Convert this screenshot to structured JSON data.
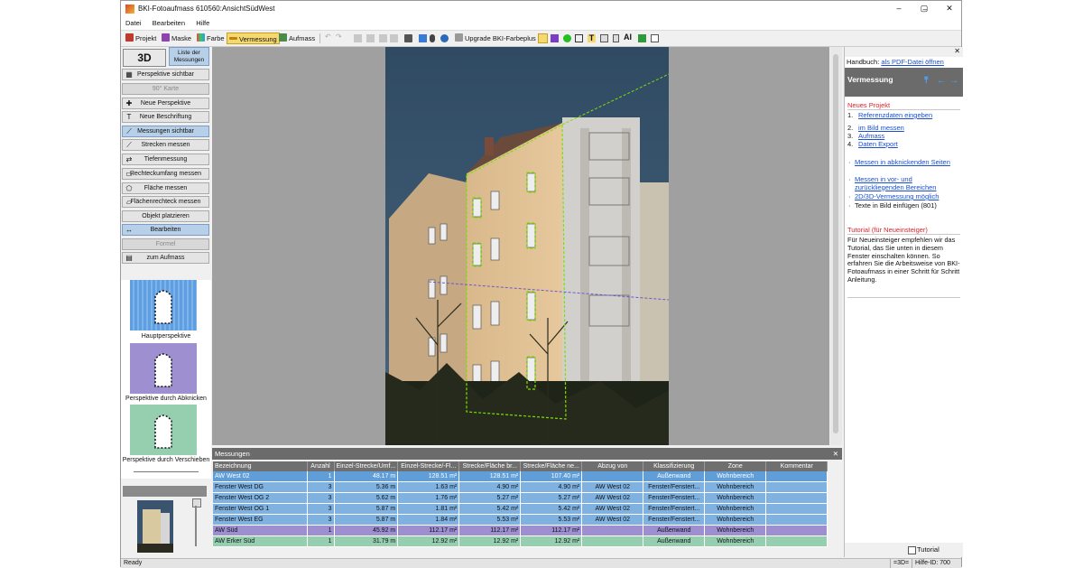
{
  "window": {
    "title": "BKI-Fotoaufmass 610560:AnsichtSüdWest"
  },
  "menu": [
    "Datei",
    "Bearbeiten",
    "Hilfe"
  ],
  "toolbar": {
    "projekt": "Projekt",
    "maske": "Maske",
    "farbe": "Farbe",
    "vermessung": "Vermessung",
    "aufmass": "Aufmass",
    "upgrade": "Upgrade BKI-Farbeplus",
    "ai": "AI",
    "t": "T"
  },
  "left_panel": {
    "btn_3d": "3D",
    "btn_liste": "Liste der Messungen",
    "items": [
      {
        "label": "Perspektive sichtbar",
        "state": "normal",
        "icon": "perspective-icon"
      },
      {
        "label": "90° Karte",
        "state": "disabled",
        "icon": ""
      },
      {
        "label": "Neue Perspektive",
        "state": "normal",
        "icon": "new-perspective-icon"
      },
      {
        "label": "Neue Beschriftung",
        "state": "normal",
        "icon": "text-icon"
      },
      {
        "label": "Messungen sichtbar",
        "state": "selected",
        "icon": "measure-visible-icon"
      },
      {
        "label": "Strecken messen",
        "state": "normal",
        "icon": "distance-icon"
      },
      {
        "label": "Tiefenmessung",
        "state": "normal",
        "icon": "depth-icon"
      },
      {
        "label": "Rechteckumfang messen",
        "state": "normal",
        "icon": "rectangle-icon"
      },
      {
        "label": "Fläche messen",
        "state": "normal",
        "icon": "area-icon"
      },
      {
        "label": "Flächenrechteck messen",
        "state": "normal",
        "icon": "area-rectangle-icon"
      },
      {
        "label": "Objekt platzieren",
        "state": "normal",
        "icon": ""
      },
      {
        "label": "Bearbeiten",
        "state": "selected",
        "icon": "edit-icon"
      },
      {
        "label": "Formel",
        "state": "disabled",
        "icon": ""
      },
      {
        "label": "zum Aufmass",
        "state": "normal",
        "icon": "aufmass-icon"
      }
    ],
    "perspectives": [
      {
        "label": "Hauptperspektive",
        "color": "#5f9ee0"
      },
      {
        "label": "Perspektive durch Abknicken",
        "color": "#9d8fd0"
      },
      {
        "label": "Perspektive durch Verschieben",
        "color": "#95cfb0"
      }
    ]
  },
  "measurements": {
    "panel_title": "Messungen",
    "columns": [
      "Bezeichnung",
      "Anzahl",
      "Einzel-Strecke/Umf...",
      "Einzel-Strecke/-Fl...",
      "Strecke/Fläche br...",
      "Strecke/Fläche ne...",
      "Abzug von",
      "Klassifizierung",
      "Zone",
      "Kommentar"
    ],
    "rows": [
      {
        "name": "AW West 02",
        "count": "1",
        "len": "48.17 m",
        "area": "128.51 m²",
        "gross": "128.51 m²",
        "net": "107.40 m²",
        "abzug": "",
        "klass": "Außenwand",
        "zone": "Wohnbereich",
        "kommentar": "",
        "color": "selected"
      },
      {
        "name": "Fenster West DG",
        "count": "3",
        "len": "5.36 m",
        "area": "1.63 m²",
        "gross": "4.90 m²",
        "net": "4.90 m²",
        "abzug": "AW West 02",
        "klass": "Fenster/Fenstert...",
        "zone": "Wohnbereich",
        "kommentar": "",
        "color": "blue"
      },
      {
        "name": "Fenster West OG 2",
        "count": "3",
        "len": "5.62 m",
        "area": "1.76 m²",
        "gross": "5.27 m²",
        "net": "5.27 m²",
        "abzug": "AW West 02",
        "klass": "Fenster/Fenstert...",
        "zone": "Wohnbereich",
        "kommentar": "",
        "color": "blue"
      },
      {
        "name": "Fenster West OG 1",
        "count": "3",
        "len": "5.87 m",
        "area": "1.81 m²",
        "gross": "5.42 m²",
        "net": "5.42 m²",
        "abzug": "AW West 02",
        "klass": "Fenster/Fenstert...",
        "zone": "Wohnbereich",
        "kommentar": "",
        "color": "blue"
      },
      {
        "name": "Fenster West EG",
        "count": "3",
        "len": "5.87 m",
        "area": "1.84 m²",
        "gross": "5.53 m²",
        "net": "5.53 m²",
        "abzug": "AW West 02",
        "klass": "Fenster/Fenstert...",
        "zone": "Wohnbereich",
        "kommentar": "",
        "color": "blue"
      },
      {
        "name": "AW Süd",
        "count": "1",
        "len": "45.92 m",
        "area": "112.17 m²",
        "gross": "112.17 m²",
        "net": "112.17 m²",
        "abzug": "",
        "klass": "Außenwand",
        "zone": "Wohnbereich",
        "kommentar": "",
        "color": "purple"
      },
      {
        "name": "AW Erker Süd",
        "count": "1",
        "len": "31.79 m",
        "area": "12.92 m²",
        "gross": "12.92 m²",
        "net": "12.92 m²",
        "abzug": "",
        "klass": "Außenwand",
        "zone": "Wohnbereich",
        "kommentar": "",
        "color": "green"
      }
    ]
  },
  "right_panel": {
    "handbuch_label": "Handbuch:",
    "handbuch_link": "als PDF-Datei öffnen",
    "title": "Vermessung",
    "section1": "Neues Projekt",
    "steps": [
      {
        "n": "1.",
        "text": "Referenzdaten eingeben"
      },
      {
        "n": "2.",
        "text": "im Bild messen"
      },
      {
        "n": "3.",
        "text": "Aufmass"
      },
      {
        "n": "4.",
        "text": "Daten Export"
      }
    ],
    "bullets": [
      {
        "text": "Messen in abknickenden Seiten",
        "link": true
      },
      {
        "text": "Messen in vor- und zurückliegenden Bereichen",
        "link": true
      },
      {
        "text": "2D/3D-Vermessung möglich",
        "link": true
      },
      {
        "text": "Texte in Bild einfügen (801)",
        "link": false
      }
    ],
    "section2": "Tutorial (für Neueinsteiger)",
    "tutorial_text": "Für Neueinsteiger empfehlen wir das Tutorial, das Sie unten in diesem Fenster einschalten können. So erfahren Sie die Arbeitsweise von BKI-Fotoaufmass in einer Schritt für Schritt Anleitung.",
    "tutorial_checkbox": "Tutorial"
  },
  "status": {
    "left": "Ready",
    "right1": "=3D=",
    "right2": "Hilfe-ID: 700"
  }
}
